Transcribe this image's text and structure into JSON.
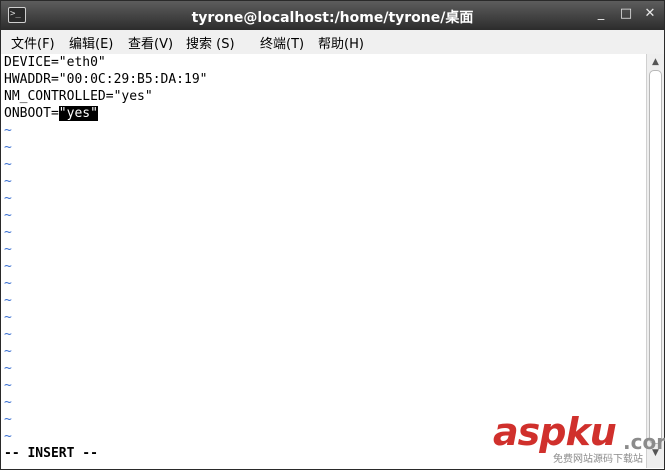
{
  "window": {
    "title": "tyrone@localhost:/home/tyrone/桌面",
    "icon_glyph": ">_",
    "controls": {
      "minimize": "_",
      "maximize": "□",
      "close": "✕"
    }
  },
  "menu": {
    "items": [
      {
        "label": "文件(F)"
      },
      {
        "label": "编辑(E)"
      },
      {
        "label": "查看(V)"
      },
      {
        "label": "搜索 (S)"
      },
      {
        "label": "终端(T)"
      },
      {
        "label": "帮助(H)"
      }
    ]
  },
  "editor": {
    "lines": [
      "DEVICE=\"eth0\"",
      "HWADDR=\"00:0C:29:B5:DA:19\"",
      "NM_CONTROLLED=\"yes\""
    ],
    "onboot_prefix": "ONBOOT=",
    "onboot_selected": "\"yes\"",
    "empty_marker": "~",
    "mode": "-- INSERT --"
  },
  "scrollbar": {
    "up": "▲",
    "down": "▼"
  },
  "watermark": {
    "brand": "aspku",
    "suffix": ".com",
    "tagline": "免费网站源码下载站"
  },
  "colors": {
    "titlebar": "#2c2c2c",
    "tilde": "#3a6fd0",
    "selection": "#000000",
    "watermark": "#d0302c"
  }
}
